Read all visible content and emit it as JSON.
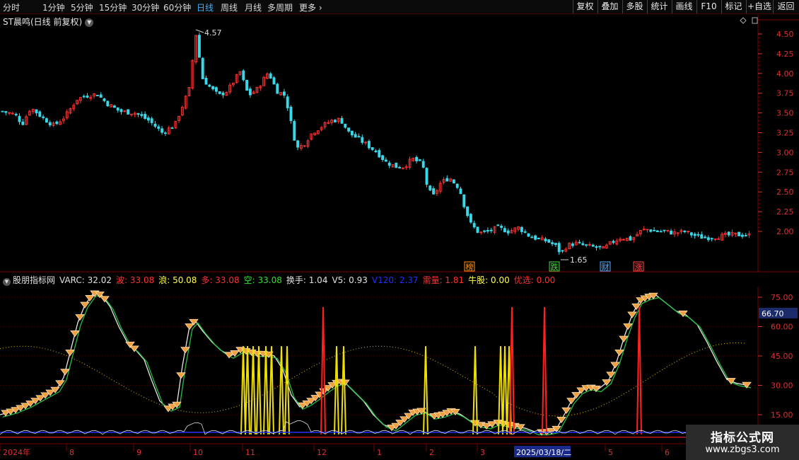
{
  "toolbar": {
    "periods": [
      "分时",
      "1分钟",
      "5分钟",
      "15分钟",
      "30分钟",
      "60分钟",
      "日线",
      "周线",
      "月线",
      "多周期"
    ],
    "active_period": "日线",
    "more_label": "更多",
    "right_buttons": [
      "复权",
      "叠加",
      "多股",
      "统计",
      "画线",
      "F10",
      "标记",
      "+自选",
      "返回"
    ]
  },
  "stock": {
    "title": "ST晨鸣(日线 前复权)",
    "high_label": "4.57",
    "low_label": "1.65",
    "event_markers": [
      {
        "label": "榜",
        "color": "#ff8c00"
      },
      {
        "label": "跌",
        "color": "#3cd33c"
      },
      {
        "label": "财",
        "color": "#4aa8ff"
      },
      {
        "label": "涨",
        "color": "#ff4040"
      }
    ],
    "price_axis": [
      "4.50",
      "4.25",
      "4.00",
      "3.75",
      "3.50",
      "3.25",
      "3.00",
      "2.75",
      "2.50",
      "2.25",
      "2.00"
    ]
  },
  "indicator": {
    "name": "股朋指标网",
    "values": [
      {
        "label": "VARC:",
        "value": "32.02",
        "color": "#e0e0e0"
      },
      {
        "label": "波:",
        "value": "33.08",
        "color": "#ff3030"
      },
      {
        "label": "浪:",
        "value": "50.08",
        "color": "#ffff40"
      },
      {
        "label": "多:",
        "value": "33.08",
        "color": "#ff3030"
      },
      {
        "label": "空:",
        "value": "33.08",
        "color": "#30e030"
      },
      {
        "label": "换手:",
        "value": "1.04",
        "color": "#e0e0e0"
      },
      {
        "label": "V5:",
        "value": "0.93",
        "color": "#e0e0e0"
      },
      {
        "label": "V120:",
        "value": "2.37",
        "color": "#2030ff"
      },
      {
        "label": "需量:",
        "value": "1.81",
        "color": "#ff3030"
      },
      {
        "label": "牛股:",
        "value": "0.00",
        "color": "#ffff40"
      },
      {
        "label": "优选:",
        "value": "0.00",
        "color": "#ff3030"
      }
    ],
    "axis": [
      "75.00",
      "60.00",
      "45.00",
      "30.00",
      "15.00"
    ],
    "current_value": "66.70"
  },
  "time_axis": {
    "labels": [
      "2024年",
      "8",
      "9",
      "10",
      "11",
      "12",
      "1",
      "2",
      "3",
      "5",
      "6"
    ],
    "cursor_date": "2025/03/18/二"
  },
  "watermark": {
    "line1": "指标公式网",
    "line2": "www.zbgs3.com"
  },
  "colors": {
    "up": "#ff3030",
    "down": "#38d8e8",
    "grid": "#7a0000",
    "axis_text": "#e03030",
    "accent_blue": "#3ab0ff"
  }
}
